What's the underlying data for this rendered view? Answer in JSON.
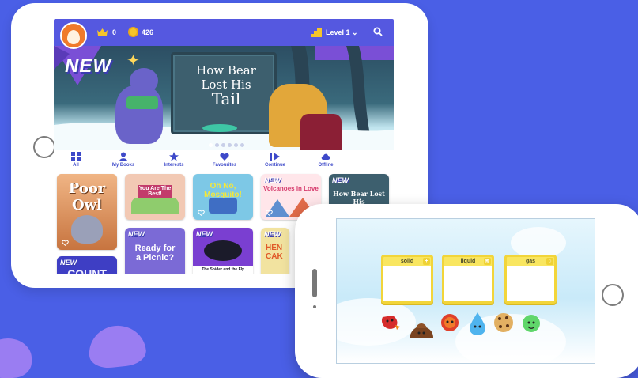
{
  "tablet": {
    "topbar": {
      "crowns": "0",
      "coins": "426",
      "level": "Level 1 ⌄"
    },
    "hero": {
      "badge": "NEW",
      "title_line1": "How Bear",
      "title_line2": "Lost His",
      "title_line3": "Tail",
      "dots_total": 6,
      "dots_active": 1
    },
    "nav": [
      {
        "label": "All",
        "icon": "grid-icon"
      },
      {
        "label": "My Books",
        "icon": "person-icon"
      },
      {
        "label": "Interests",
        "icon": "star-icon"
      },
      {
        "label": "Favourites",
        "icon": "heart-icon"
      },
      {
        "label": "Continue",
        "icon": "play-icon"
      },
      {
        "label": "Offline",
        "icon": "cloud-download-icon"
      }
    ],
    "books": [
      {
        "title": "Poor Owl",
        "badge": ""
      },
      {
        "title": "You Are The Best!",
        "badge": ""
      },
      {
        "title": "Oh No, Mosquito!",
        "badge": ""
      },
      {
        "title": "Volcanoes in Love",
        "badge": "NEW"
      },
      {
        "title": "How Bear Lost His",
        "badge": "NEW"
      },
      {
        "title": "COUNT",
        "badge": "NEW"
      },
      {
        "title": "Ready for a Picnic?",
        "badge": "NEW"
      },
      {
        "title": "The Spider and the Fly",
        "badge": "NEW"
      },
      {
        "title": "HEN CAK",
        "badge": "NEW"
      }
    ]
  },
  "phone": {
    "bins": [
      {
        "label": "solid",
        "tag": "+"
      },
      {
        "label": "liquid",
        "tag": "≋"
      },
      {
        "label": "gas",
        "tag": "○"
      }
    ],
    "items": [
      "red-berry",
      "brown-mud",
      "red-lava",
      "water-drop",
      "cookie",
      "green-gas"
    ]
  }
}
